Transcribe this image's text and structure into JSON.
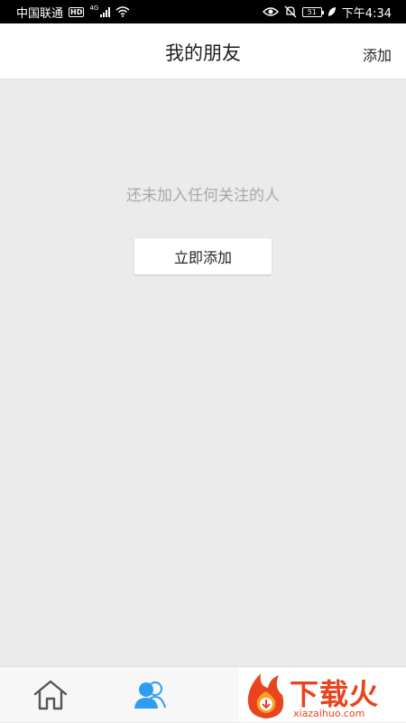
{
  "status_bar": {
    "carrier": "中国联通",
    "hd": "HD",
    "network": "4G",
    "battery": "51",
    "time": "下午4:34"
  },
  "header": {
    "title": "我的朋友",
    "add_label": "添加"
  },
  "empty_state": {
    "message": "还未加入任何关注的人",
    "button_label": "立即添加"
  },
  "tab_bar": {
    "items": [
      {
        "icon": "home-icon"
      },
      {
        "icon": "friends-icon",
        "active": true
      }
    ]
  },
  "watermark": {
    "title": "下载火",
    "url": "xiazaihuo.com"
  },
  "colors": {
    "accent": "#2e9df0",
    "background": "#ebebeb",
    "watermark": "#e8451e"
  }
}
